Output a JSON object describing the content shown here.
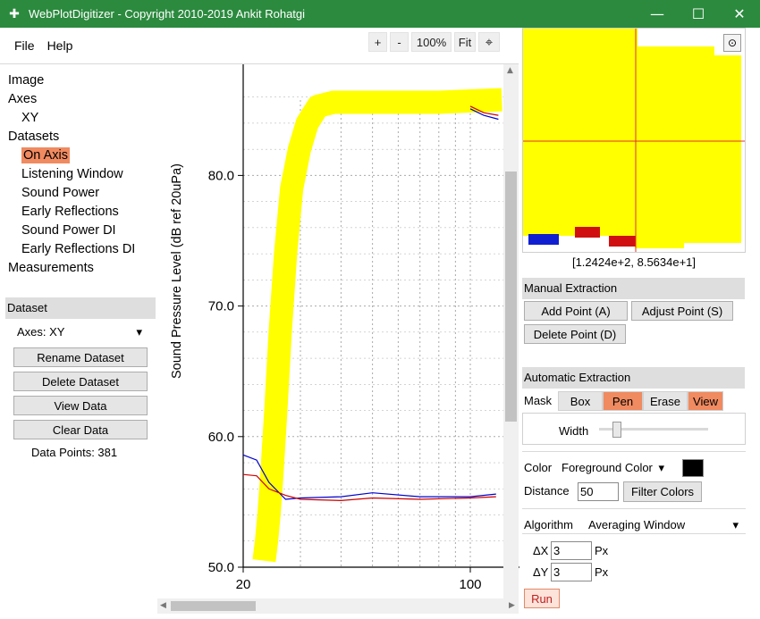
{
  "window": {
    "title": "WebPlotDigitizer - Copyright 2010-2019 Ankit Rohatgi",
    "icon": "wpd-app-icon",
    "minimize": "—",
    "maximize": "☐",
    "close": "✕"
  },
  "menu": {
    "file": "File",
    "help": "Help"
  },
  "zoom": {
    "plus": "+",
    "minus": "-",
    "level": "100%",
    "fit": "Fit",
    "crosshair": "⌖"
  },
  "tree": {
    "image": "Image",
    "axes": "Axes",
    "xy": "XY",
    "datasets": "Datasets",
    "dataset_items": [
      "On Axis",
      "Listening Window",
      "Sound Power",
      "Early Reflections",
      "Sound Power DI",
      "Early Reflections DI"
    ],
    "measurements": "Measurements"
  },
  "dataset_panel": {
    "header": "Dataset",
    "axes_label": "Axes:  XY",
    "axes_caret": "▾",
    "rename": "Rename Dataset",
    "delete": "Delete Dataset",
    "view": "View Data",
    "clear": "Clear Data",
    "data_points": "Data Points: 381"
  },
  "chart_data": {
    "type": "line",
    "ylabel": "Sound Pressure Level (dB ref 20uPa)",
    "yticks": [
      "50.0",
      "60.0",
      "70.0",
      "80.0"
    ],
    "xticks": [
      "20",
      "100"
    ],
    "x_scale": "log",
    "ylim": [
      50,
      87
    ],
    "grid": true,
    "series": [
      {
        "color": "#0000cc",
        "x": [
          20,
          22,
          24,
          27,
          30,
          40,
          50,
          70,
          100,
          120
        ],
        "y": [
          58.6,
          58.2,
          56.5,
          55.2,
          55.3,
          55.4,
          55.7,
          55.4,
          55.4,
          55.6
        ]
      },
      {
        "color": "#cc0000",
        "x": [
          20,
          22,
          24,
          27,
          30,
          40,
          50,
          70,
          100,
          120
        ],
        "y": [
          57.1,
          57.0,
          56.0,
          55.5,
          55.2,
          55.1,
          55.3,
          55.2,
          55.3,
          55.4
        ]
      },
      {
        "color": "#cc0000",
        "x": [
          100,
          110,
          122
        ],
        "y": [
          85.3,
          84.8,
          84.6
        ]
      },
      {
        "color": "#0000cc",
        "x": [
          100,
          110,
          122
        ],
        "y": [
          85.1,
          84.6,
          84.3
        ]
      }
    ],
    "mask_color": "#ffff00"
  },
  "magnifier": {
    "coords": "[1.2424e+2, 8.5634e+1]",
    "target": "⊙"
  },
  "manual": {
    "header": "Manual Extraction",
    "add": "Add Point (A)",
    "adjust": "Adjust Point (S)",
    "delete": "Delete Point (D)"
  },
  "auto": {
    "header": "Automatic Extraction",
    "mask_label": "Mask",
    "box": "Box",
    "pen": "Pen",
    "erase": "Erase",
    "view": "View",
    "width_label": "Width",
    "color_label": "Color",
    "color_mode": "Foreground Color",
    "color_caret": "▾",
    "color_value": "#000000",
    "distance_label": "Distance",
    "distance_value": "50",
    "filter": "Filter Colors",
    "algorithm_label": "Algorithm",
    "algorithm_value": "Averaging Window",
    "algorithm_caret": "▾",
    "dx_label": "ΔX",
    "dx_value": "3",
    "dx_unit": "Px",
    "dy_label": "ΔY",
    "dy_value": "3",
    "dy_unit": "Px",
    "run": "Run"
  }
}
